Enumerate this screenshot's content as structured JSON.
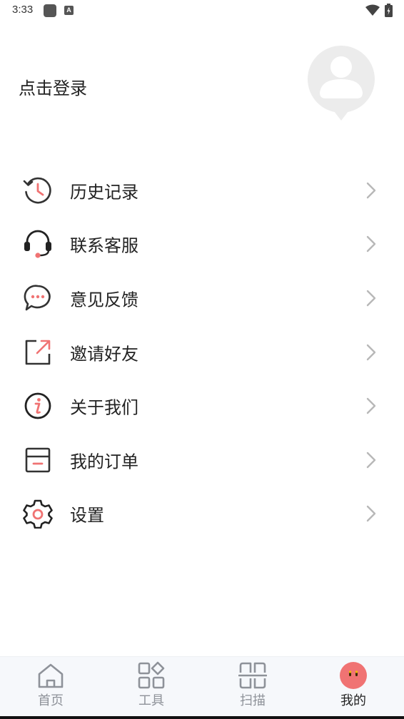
{
  "status_bar": {
    "time": "3:33",
    "notification_badge": "A"
  },
  "profile": {
    "login_text": "点击登录",
    "avatar_icon": "user-avatar-icon"
  },
  "menu": {
    "items": [
      {
        "label": "历史记录",
        "icon": "history-icon"
      },
      {
        "label": "联系客服",
        "icon": "headset-icon"
      },
      {
        "label": "意见反馈",
        "icon": "chat-bubble-icon"
      },
      {
        "label": "邀请好友",
        "icon": "share-icon"
      },
      {
        "label": "关于我们",
        "icon": "info-icon"
      },
      {
        "label": "我的订单",
        "icon": "order-icon"
      },
      {
        "label": "设置",
        "icon": "gear-icon"
      }
    ]
  },
  "tabbar": {
    "tabs": [
      {
        "label": "首页",
        "icon": "home-icon",
        "active": false
      },
      {
        "label": "工具",
        "icon": "tools-icon",
        "active": false
      },
      {
        "label": "扫描",
        "icon": "scan-icon",
        "active": false
      },
      {
        "label": "我的",
        "icon": "mine-icon",
        "active": true
      }
    ]
  },
  "colors": {
    "accent": "#f07373",
    "text": "#222222",
    "muted": "#8e9299",
    "icon_dark": "#333333"
  }
}
